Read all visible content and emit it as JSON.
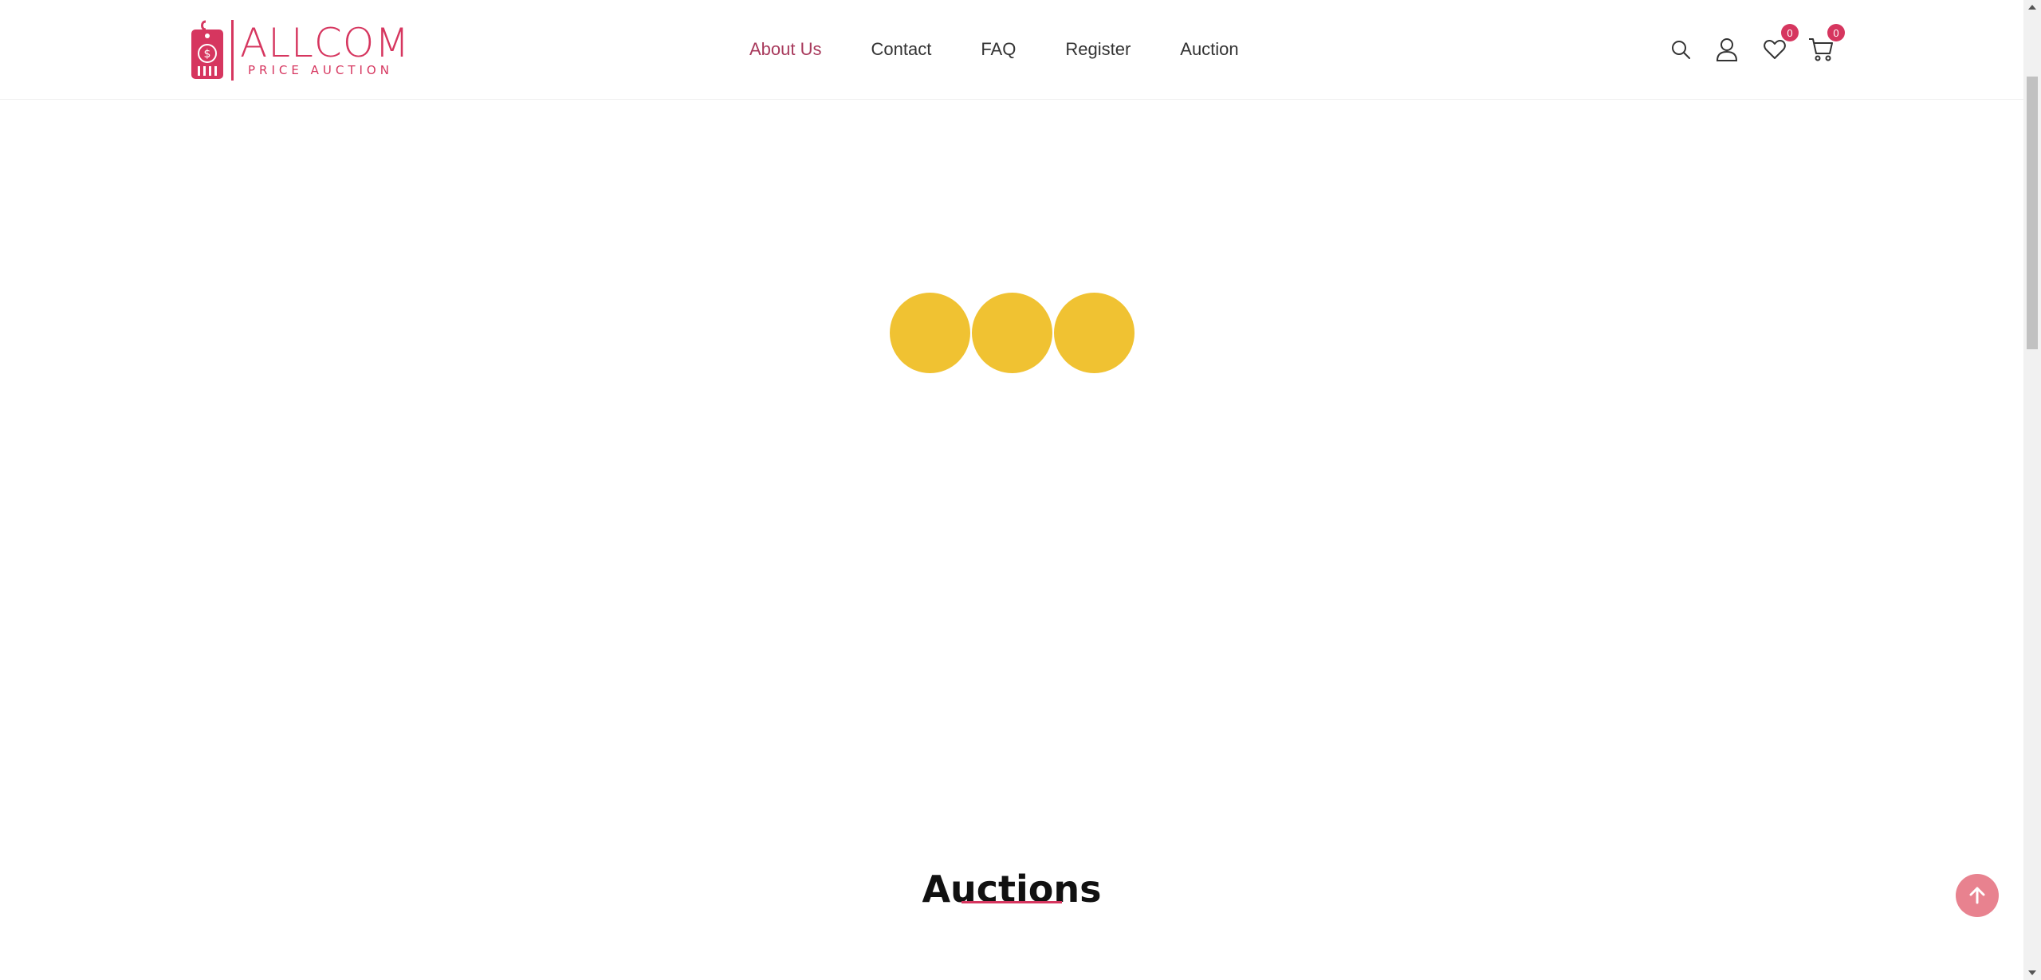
{
  "brand": {
    "name": "ALLCOM",
    "tagline": "PRICE AUCTION",
    "color": "#d6365f"
  },
  "nav": {
    "items": [
      {
        "label": "About Us",
        "active": true
      },
      {
        "label": "Contact",
        "active": false
      },
      {
        "label": "FAQ",
        "active": false
      },
      {
        "label": "Register",
        "active": false
      },
      {
        "label": "Auction",
        "active": false
      }
    ],
    "active_color": "#a83a5c"
  },
  "header_icons": {
    "search": "search-icon",
    "account": "user-icon",
    "wishlist": {
      "icon": "heart-icon",
      "count": "0"
    },
    "cart": {
      "icon": "cart-icon",
      "count": "0"
    }
  },
  "loader": {
    "dot_color": "#f0c232",
    "dots": 3
  },
  "section": {
    "title": "Auctions",
    "underline_color": "#d6365f"
  },
  "scroll_top": {
    "icon": "arrow-up-icon",
    "color": "#e8828f"
  }
}
